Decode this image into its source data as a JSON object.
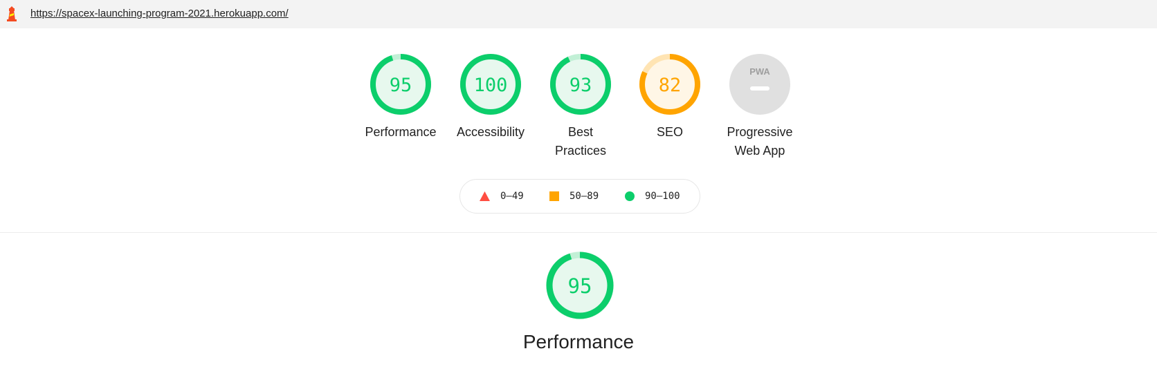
{
  "header": {
    "url": "https://spacex-launching-program-2021.herokuapp.com/",
    "logo_icon": "lighthouse-icon"
  },
  "colors": {
    "pass": "#0cce6b",
    "average": "#ffa400",
    "fail": "#ff4e42",
    "na": "#e0e0e0"
  },
  "gauges": [
    {
      "id": "performance",
      "score": "95",
      "value": 95,
      "label_lines": [
        "Performance"
      ],
      "rating": "pass"
    },
    {
      "id": "accessibility",
      "score": "100",
      "value": 100,
      "label_lines": [
        "Accessibility"
      ],
      "rating": "pass"
    },
    {
      "id": "best-practices",
      "score": "93",
      "value": 93,
      "label_lines": [
        "Best",
        "Practices"
      ],
      "rating": "pass"
    },
    {
      "id": "seo",
      "score": "82",
      "value": 82,
      "label_lines": [
        "SEO"
      ],
      "rating": "average"
    },
    {
      "id": "pwa",
      "badge": "PWA",
      "label_lines": [
        "Progressive",
        "Web App"
      ],
      "rating": "na"
    }
  ],
  "legend": [
    {
      "range": "0–49",
      "shape": "triangle",
      "rating": "fail"
    },
    {
      "range": "50–89",
      "shape": "square",
      "rating": "average"
    },
    {
      "range": "90–100",
      "shape": "circle",
      "rating": "pass"
    }
  ],
  "category_section": {
    "score": "95",
    "value": 95,
    "title": "Performance",
    "rating": "pass"
  }
}
